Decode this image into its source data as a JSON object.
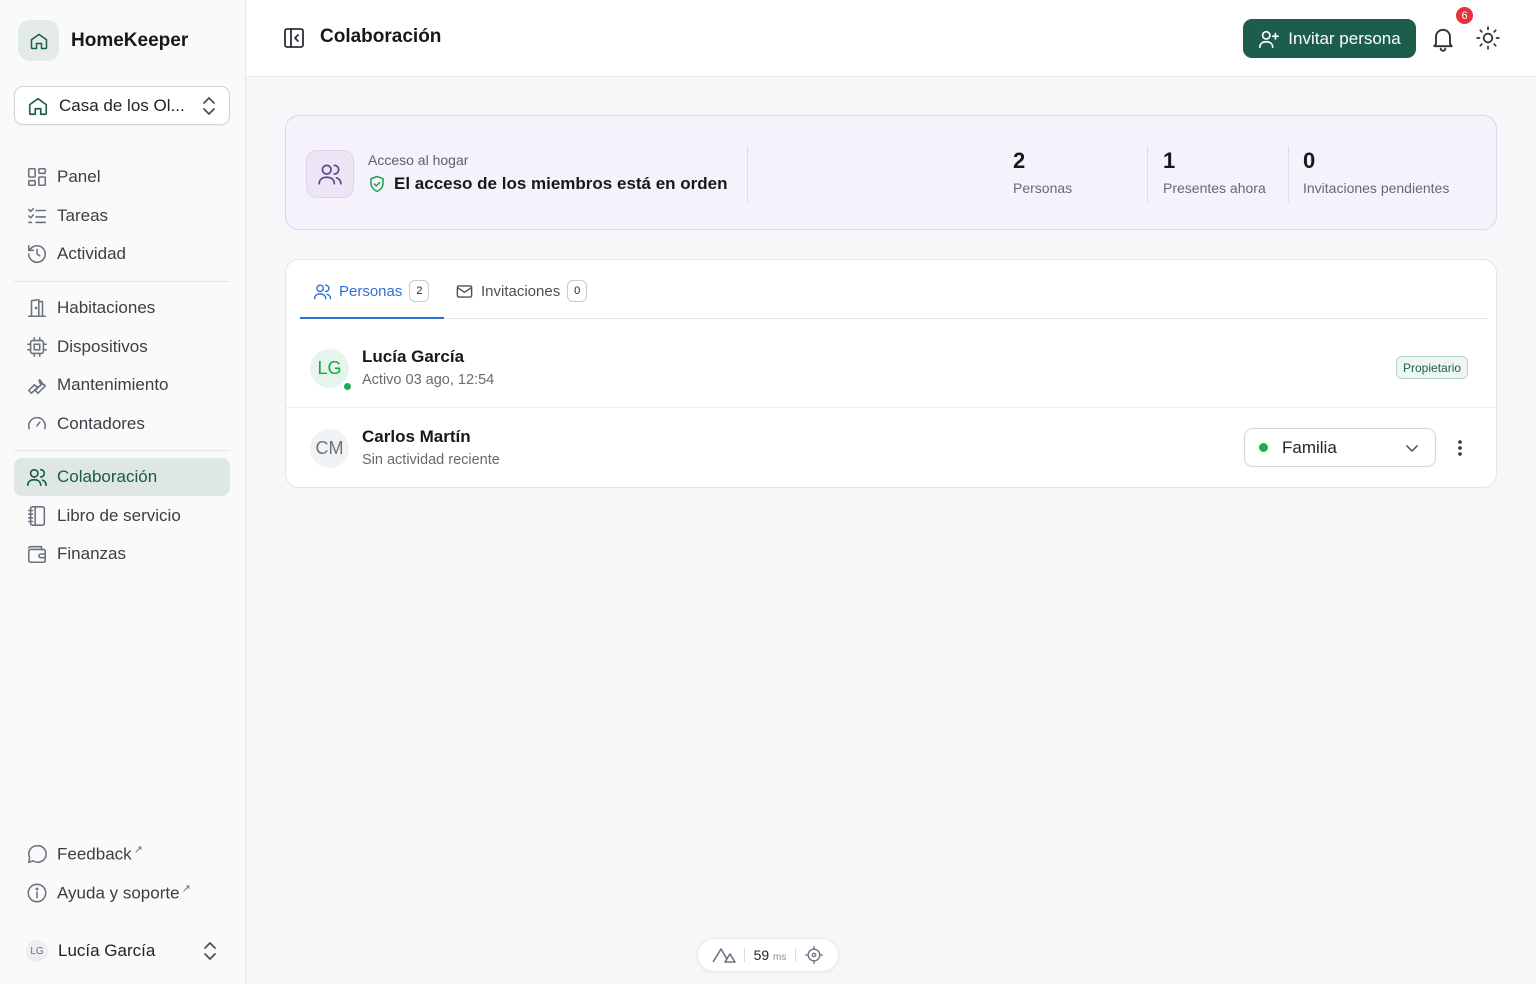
{
  "app": {
    "name": "HomeKeeper"
  },
  "home_selector": {
    "label": "Casa de los Ol..."
  },
  "nav": {
    "main": [
      {
        "label": "Panel",
        "icon": "grid-icon"
      },
      {
        "label": "Tareas",
        "icon": "checklist-icon"
      },
      {
        "label": "Actividad",
        "icon": "history-icon"
      }
    ],
    "home": [
      {
        "label": "Habitaciones",
        "icon": "door-icon"
      },
      {
        "label": "Dispositivos",
        "icon": "chip-icon"
      },
      {
        "label": "Mantenimiento",
        "icon": "wrench-icon"
      },
      {
        "label": "Contadores",
        "icon": "gauge-icon"
      }
    ],
    "manage": [
      {
        "label": "Colaboración",
        "icon": "users-icon",
        "active": true
      },
      {
        "label": "Libro de servicio",
        "icon": "notebook-icon"
      },
      {
        "label": "Finanzas",
        "icon": "wallet-icon"
      }
    ],
    "footer": [
      {
        "label": "Feedback",
        "icon": "message-icon"
      },
      {
        "label": "Ayuda y soporte",
        "icon": "info-icon"
      }
    ]
  },
  "user": {
    "initials": "LG",
    "name": "Lucía García"
  },
  "header": {
    "title": "Colaboración",
    "invite_label": "Invitar persona",
    "notifications_count": "6"
  },
  "summary": {
    "kicker": "Acceso al hogar",
    "status": "El acceso de los miembros está en orden",
    "stats": [
      {
        "value": "2",
        "label": "Personas"
      },
      {
        "value": "1",
        "label": "Presentes ahora"
      },
      {
        "value": "0",
        "label": "Invitaciones pendientes"
      }
    ]
  },
  "tabs": [
    {
      "label": "Personas",
      "count": "2",
      "active": true
    },
    {
      "label": "Invitaciones",
      "count": "0"
    }
  ],
  "members": [
    {
      "initials": "LG",
      "name": "Lucía García",
      "sub": "Activo 03 ago, 12:54",
      "role": "Propietario",
      "online": true
    },
    {
      "initials": "CM",
      "name": "Carlos Martín",
      "sub": "Sin actividad reciente",
      "role": "Familia",
      "online": false
    }
  ],
  "perf": {
    "value": "59",
    "unit": "ms"
  },
  "colors": {
    "accent": "#1c5d4b",
    "tab_active": "#2f6fd6",
    "badge": "#e5323b",
    "online": "#16b04f"
  }
}
